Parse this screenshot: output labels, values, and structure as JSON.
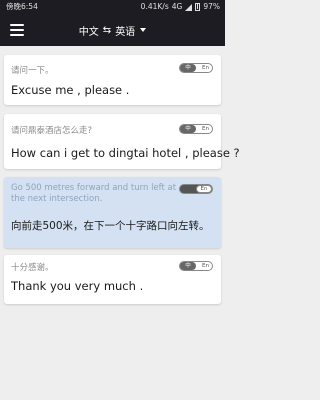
{
  "status_bar": {
    "time": "傍晚6:54",
    "network_speed": "0.41K/s",
    "network_type": "4G",
    "battery": "97%"
  },
  "header": {
    "source_language": "中文",
    "swap_symbol": "⇆",
    "target_language": "英语"
  },
  "conversation": [
    {
      "source": "请问一下。",
      "target": "Excuse me , please .",
      "toggle_left": "中",
      "toggle_right": "En"
    },
    {
      "source": "请问鼎泰酒店怎么走?",
      "target": "How can i get to dingtai hotel , please ?",
      "toggle_left": "中",
      "toggle_right": "En"
    },
    {
      "source": "Go 500 metres forward and turn left at the next intersection.",
      "target": "向前走500米，在下一个十字路口向左转。",
      "toggle_left": "中",
      "toggle_right": "En"
    },
    {
      "source": "十分感谢。",
      "target": "Thank you very much .",
      "toggle_left": "中",
      "toggle_right": "En"
    }
  ],
  "colors": {
    "bar_bg": "#1c1c22",
    "page_bg": "#eeeeee",
    "active_card_bg": "#d3e1f2"
  },
  "icons": [
    "menu-icon",
    "signal-icon",
    "battery-icon"
  ]
}
